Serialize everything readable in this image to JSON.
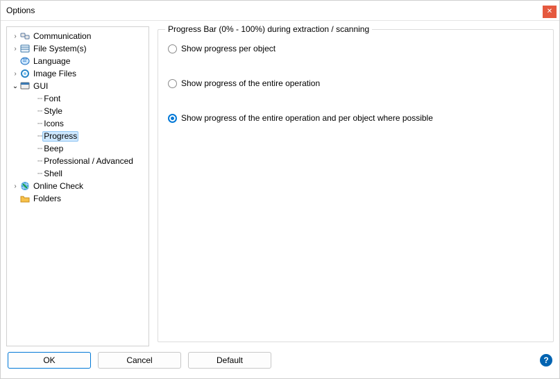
{
  "window": {
    "title": "Options"
  },
  "tree": {
    "items": [
      {
        "id": "communication",
        "label": "Communication",
        "expandable": true,
        "expanded": false,
        "icon": "communication",
        "depth": 0
      },
      {
        "id": "filesystems",
        "label": "File System(s)",
        "expandable": true,
        "expanded": false,
        "icon": "filesystem",
        "depth": 0
      },
      {
        "id": "language",
        "label": "Language",
        "expandable": false,
        "expanded": false,
        "icon": "language",
        "depth": 0
      },
      {
        "id": "imagefiles",
        "label": "Image Files",
        "expandable": true,
        "expanded": false,
        "icon": "imagefiles",
        "depth": 0
      },
      {
        "id": "gui",
        "label": "GUI",
        "expandable": true,
        "expanded": true,
        "icon": "gui",
        "depth": 0
      },
      {
        "id": "font",
        "label": "Font",
        "expandable": false,
        "expanded": false,
        "icon": "dots",
        "depth": 1
      },
      {
        "id": "style",
        "label": "Style",
        "expandable": false,
        "expanded": false,
        "icon": "dots",
        "depth": 1
      },
      {
        "id": "icons",
        "label": "Icons",
        "expandable": false,
        "expanded": false,
        "icon": "dots",
        "depth": 1
      },
      {
        "id": "progress",
        "label": "Progress",
        "expandable": false,
        "expanded": false,
        "icon": "dots",
        "depth": 1,
        "selected": true
      },
      {
        "id": "beep",
        "label": "Beep",
        "expandable": false,
        "expanded": false,
        "icon": "dots",
        "depth": 1
      },
      {
        "id": "pro",
        "label": "Professional / Advanced",
        "expandable": false,
        "expanded": false,
        "icon": "dots",
        "depth": 1
      },
      {
        "id": "shell",
        "label": "Shell",
        "expandable": false,
        "expanded": false,
        "icon": "dots",
        "depth": 1
      },
      {
        "id": "onlinecheck",
        "label": "Online Check",
        "expandable": true,
        "expanded": false,
        "icon": "onlinecheck",
        "depth": 0
      },
      {
        "id": "folders",
        "label": "Folders",
        "expandable": false,
        "expanded": false,
        "icon": "folders",
        "depth": 0
      }
    ]
  },
  "group": {
    "legend": "Progress Bar (0% - 100%) during extraction / scanning",
    "options": [
      {
        "id": "per-object",
        "label": "Show progress per object",
        "checked": false
      },
      {
        "id": "entire-op",
        "label": "Show progress of the entire operation",
        "checked": false
      },
      {
        "id": "both",
        "label": "Show progress of the entire operation and per object where possible",
        "checked": true
      }
    ]
  },
  "buttons": {
    "ok": "OK",
    "cancel": "Cancel",
    "default": "Default"
  },
  "help_tooltip": "?"
}
